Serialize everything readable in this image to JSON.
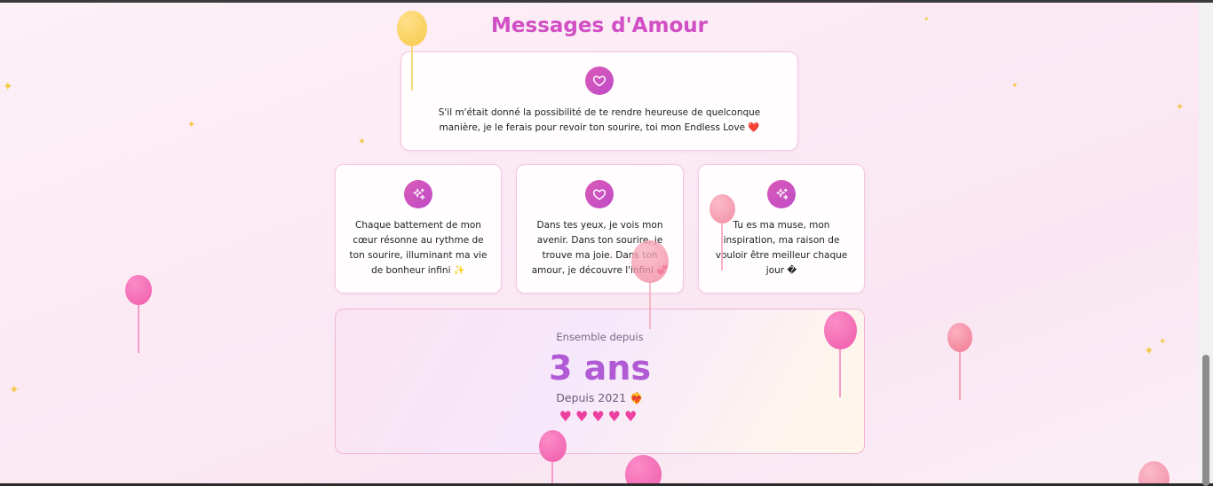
{
  "page": {
    "title": "Messages d'Amour"
  },
  "messages": [
    {
      "icon": "heart-icon",
      "text": "S'il m'était donné la possibilité de te rendre heureuse de quelconque manière, je le ferais pour revoir ton sourire, toi mon Endless Love ❤️"
    },
    {
      "icon": "sparkles-icon",
      "text": "Chaque battement de mon cœur résonne au rythme de ton sourire, illuminant ma vie de bonheur infini ✨"
    },
    {
      "icon": "heart-icon",
      "text": "Dans tes yeux, je vois mon avenir. Dans ton sourire, je trouve ma joie. Dans ton amour, je découvre l'infini 💞"
    },
    {
      "icon": "sparkles-icon",
      "text": "Tu es ma muse, mon inspiration, ma raison de vouloir être meilleur chaque jour �"
    }
  ],
  "together": {
    "label": "Ensemble depuis",
    "duration": "3 ans",
    "since": "Depuis 2021 ❤️‍🔥",
    "hearts": "♥♥♥♥♥"
  },
  "colors": {
    "title": "#d14fc4",
    "accent": "#c04bc8",
    "duration": "#b05ad6",
    "hearts": "#ec3f9f"
  }
}
